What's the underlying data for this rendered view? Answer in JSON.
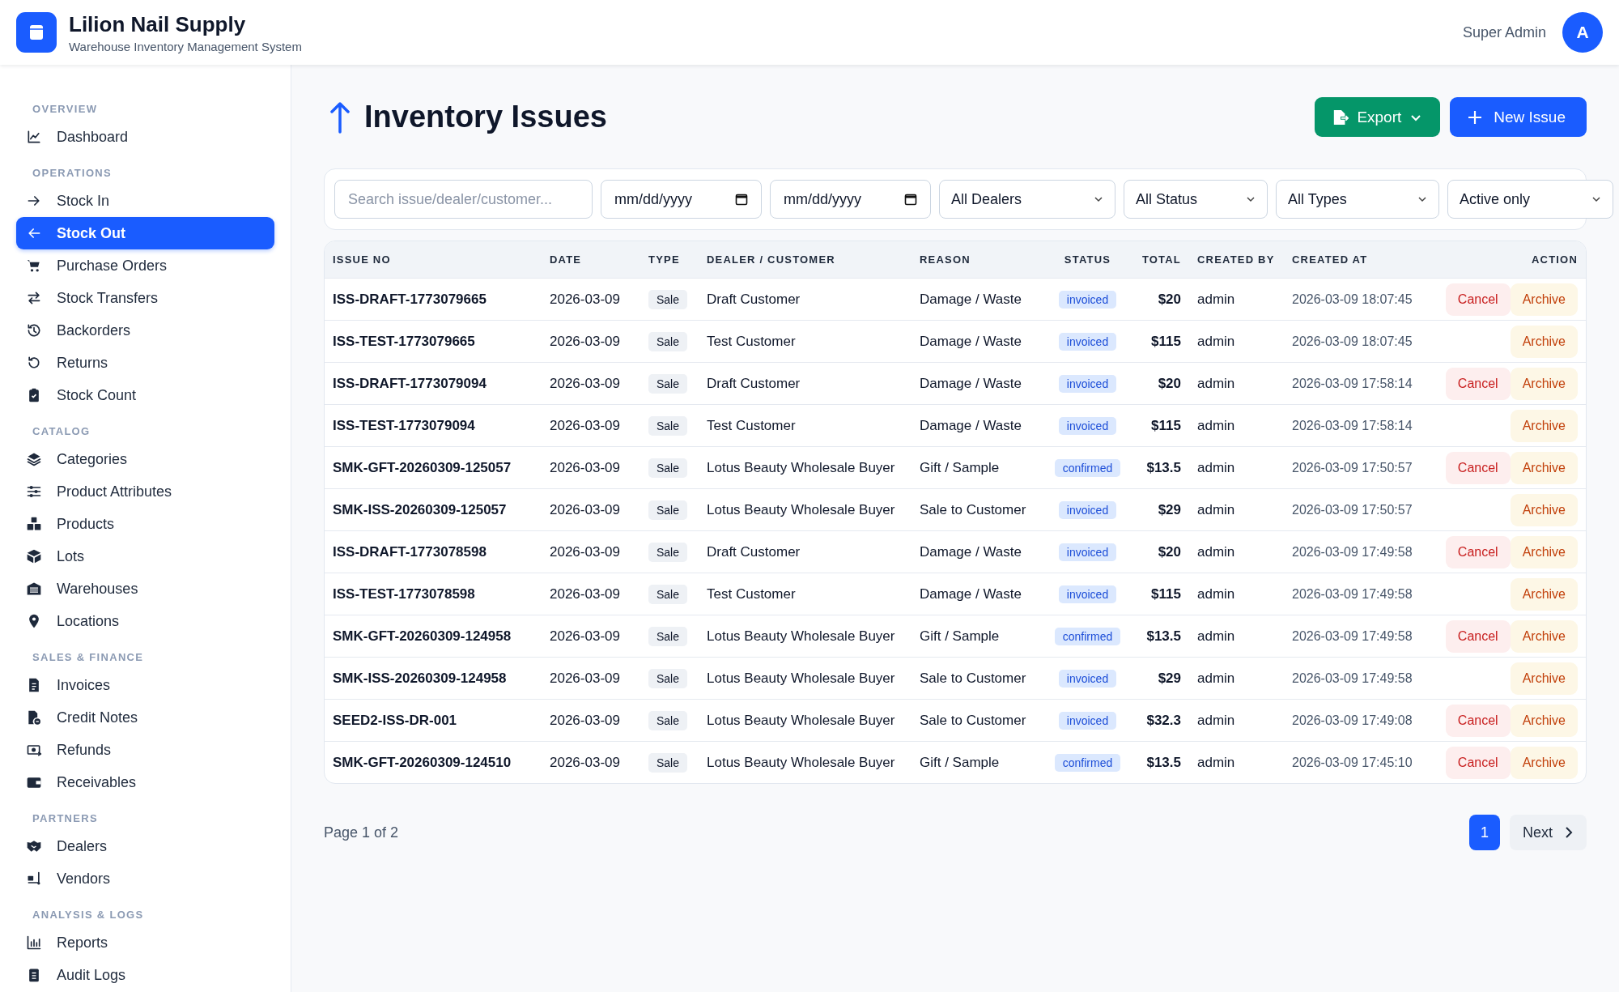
{
  "app": {
    "title": "Lilion Nail Supply",
    "subtitle": "Warehouse Inventory Management System"
  },
  "user": {
    "name": "Super Admin",
    "avatar_initial": "A"
  },
  "sidebar": {
    "sections": [
      {
        "title": "OVERVIEW",
        "items": [
          {
            "label": "Dashboard",
            "selected": false
          }
        ]
      },
      {
        "title": "OPERATIONS",
        "items": [
          {
            "label": "Stock In",
            "selected": false
          },
          {
            "label": "Stock Out",
            "selected": true
          },
          {
            "label": "Purchase Orders",
            "selected": false
          },
          {
            "label": "Stock Transfers",
            "selected": false
          },
          {
            "label": "Backorders",
            "selected": false
          },
          {
            "label": "Returns",
            "selected": false
          },
          {
            "label": "Stock Count",
            "selected": false
          }
        ]
      },
      {
        "title": "CATALOG",
        "items": [
          {
            "label": "Categories",
            "selected": false
          },
          {
            "label": "Product Attributes",
            "selected": false
          },
          {
            "label": "Products",
            "selected": false
          },
          {
            "label": "Lots",
            "selected": false
          },
          {
            "label": "Warehouses",
            "selected": false
          },
          {
            "label": "Locations",
            "selected": false
          }
        ]
      },
      {
        "title": "SALES & FINANCE",
        "items": [
          {
            "label": "Invoices",
            "selected": false
          },
          {
            "label": "Credit Notes",
            "selected": false
          },
          {
            "label": "Refunds",
            "selected": false
          },
          {
            "label": "Receivables",
            "selected": false
          }
        ]
      },
      {
        "title": "PARTNERS",
        "items": [
          {
            "label": "Dealers",
            "selected": false
          },
          {
            "label": "Vendors",
            "selected": false
          }
        ]
      },
      {
        "title": "ANALYSIS & LOGS",
        "items": [
          {
            "label": "Reports",
            "selected": false
          },
          {
            "label": "Audit Logs",
            "selected": false
          }
        ]
      }
    ]
  },
  "page": {
    "title": "Inventory Issues",
    "buttons": [
      {
        "label": "Export",
        "kind": "export"
      },
      {
        "label": "New Issue",
        "kind": "new"
      }
    ]
  },
  "filters": {
    "search": {
      "placeholder": "Search issue/dealer/customer..."
    },
    "date_from": {
      "placeholder": "mm/dd/yyyy"
    },
    "date_to": {
      "placeholder": "mm/dd/yyyy"
    },
    "selects": [
      "All Dealers",
      "All Status",
      "All Types",
      "Active only"
    ]
  },
  "table": {
    "columns": [
      "ISSUE NO",
      "DATE",
      "TYPE",
      "DEALER / CUSTOMER",
      "REASON",
      "STATUS",
      "TOTAL",
      "CREATED BY",
      "CREATED AT",
      "ACTION"
    ],
    "rows": [
      {
        "issue_no": "ISS-DRAFT-1773079665",
        "date": "2026-03-09",
        "type": "Sale",
        "dealer": "Draft Customer",
        "reason": "Damage / Waste",
        "status": "invoiced",
        "total": "$20",
        "created_by": "admin",
        "created_at": "2026-03-09 18:07:45",
        "actions": [
          {
            "label": "Cancel",
            "kind": "cancel"
          },
          {
            "label": "Archive",
            "kind": "archive"
          }
        ]
      },
      {
        "issue_no": "ISS-TEST-1773079665",
        "date": "2026-03-09",
        "type": "Sale",
        "dealer": "Test Customer",
        "reason": "Damage / Waste",
        "status": "invoiced",
        "total": "$115",
        "created_by": "admin",
        "created_at": "2026-03-09 18:07:45",
        "actions": [
          {
            "label": "Archive",
            "kind": "archive"
          }
        ]
      },
      {
        "issue_no": "ISS-DRAFT-1773079094",
        "date": "2026-03-09",
        "type": "Sale",
        "dealer": "Draft Customer",
        "reason": "Damage / Waste",
        "status": "invoiced",
        "total": "$20",
        "created_by": "admin",
        "created_at": "2026-03-09 17:58:14",
        "actions": [
          {
            "label": "Cancel",
            "kind": "cancel"
          },
          {
            "label": "Archive",
            "kind": "archive"
          }
        ]
      },
      {
        "issue_no": "ISS-TEST-1773079094",
        "date": "2026-03-09",
        "type": "Sale",
        "dealer": "Test Customer",
        "reason": "Damage / Waste",
        "status": "invoiced",
        "total": "$115",
        "created_by": "admin",
        "created_at": "2026-03-09 17:58:14",
        "actions": [
          {
            "label": "Archive",
            "kind": "archive"
          }
        ]
      },
      {
        "issue_no": "SMK-GFT-20260309-125057",
        "date": "2026-03-09",
        "type": "Sale",
        "dealer": "Lotus Beauty Wholesale Buyer",
        "reason": "Gift / Sample",
        "status": "confirmed",
        "total": "$13.5",
        "created_by": "admin",
        "created_at": "2026-03-09 17:50:57",
        "actions": [
          {
            "label": "Cancel",
            "kind": "cancel"
          },
          {
            "label": "Archive",
            "kind": "archive"
          }
        ]
      },
      {
        "issue_no": "SMK-ISS-20260309-125057",
        "date": "2026-03-09",
        "type": "Sale",
        "dealer": "Lotus Beauty Wholesale Buyer",
        "reason": "Sale to Customer",
        "status": "invoiced",
        "total": "$29",
        "created_by": "admin",
        "created_at": "2026-03-09 17:50:57",
        "actions": [
          {
            "label": "Archive",
            "kind": "archive"
          }
        ]
      },
      {
        "issue_no": "ISS-DRAFT-1773078598",
        "date": "2026-03-09",
        "type": "Sale",
        "dealer": "Draft Customer",
        "reason": "Damage / Waste",
        "status": "invoiced",
        "total": "$20",
        "created_by": "admin",
        "created_at": "2026-03-09 17:49:58",
        "actions": [
          {
            "label": "Cancel",
            "kind": "cancel"
          },
          {
            "label": "Archive",
            "kind": "archive"
          }
        ]
      },
      {
        "issue_no": "ISS-TEST-1773078598",
        "date": "2026-03-09",
        "type": "Sale",
        "dealer": "Test Customer",
        "reason": "Damage / Waste",
        "status": "invoiced",
        "total": "$115",
        "created_by": "admin",
        "created_at": "2026-03-09 17:49:58",
        "actions": [
          {
            "label": "Archive",
            "kind": "archive"
          }
        ]
      },
      {
        "issue_no": "SMK-GFT-20260309-124958",
        "date": "2026-03-09",
        "type": "Sale",
        "dealer": "Lotus Beauty Wholesale Buyer",
        "reason": "Gift / Sample",
        "status": "confirmed",
        "total": "$13.5",
        "created_by": "admin",
        "created_at": "2026-03-09 17:49:58",
        "actions": [
          {
            "label": "Cancel",
            "kind": "cancel"
          },
          {
            "label": "Archive",
            "kind": "archive"
          }
        ]
      },
      {
        "issue_no": "SMK-ISS-20260309-124958",
        "date": "2026-03-09",
        "type": "Sale",
        "dealer": "Lotus Beauty Wholesale Buyer",
        "reason": "Sale to Customer",
        "status": "invoiced",
        "total": "$29",
        "created_by": "admin",
        "created_at": "2026-03-09 17:49:58",
        "actions": [
          {
            "label": "Archive",
            "kind": "archive"
          }
        ]
      },
      {
        "issue_no": "SEED2-ISS-DR-001",
        "date": "2026-03-09",
        "type": "Sale",
        "dealer": "Lotus Beauty Wholesale Buyer",
        "reason": "Sale to Customer",
        "status": "invoiced",
        "total": "$32.3",
        "created_by": "admin",
        "created_at": "2026-03-09 17:49:08",
        "actions": [
          {
            "label": "Cancel",
            "kind": "cancel"
          },
          {
            "label": "Archive",
            "kind": "archive"
          }
        ]
      },
      {
        "issue_no": "SMK-GFT-20260309-124510",
        "date": "2026-03-09",
        "type": "Sale",
        "dealer": "Lotus Beauty Wholesale Buyer",
        "reason": "Gift / Sample",
        "status": "confirmed",
        "total": "$13.5",
        "created_by": "admin",
        "created_at": "2026-03-09 17:45:10",
        "actions": [
          {
            "label": "Cancel",
            "kind": "cancel"
          },
          {
            "label": "Archive",
            "kind": "archive"
          }
        ]
      }
    ]
  },
  "pagination": {
    "summary": "Page 1 of 2",
    "pages": [
      {
        "label": "1",
        "selected": true
      }
    ],
    "next": "Next"
  }
}
